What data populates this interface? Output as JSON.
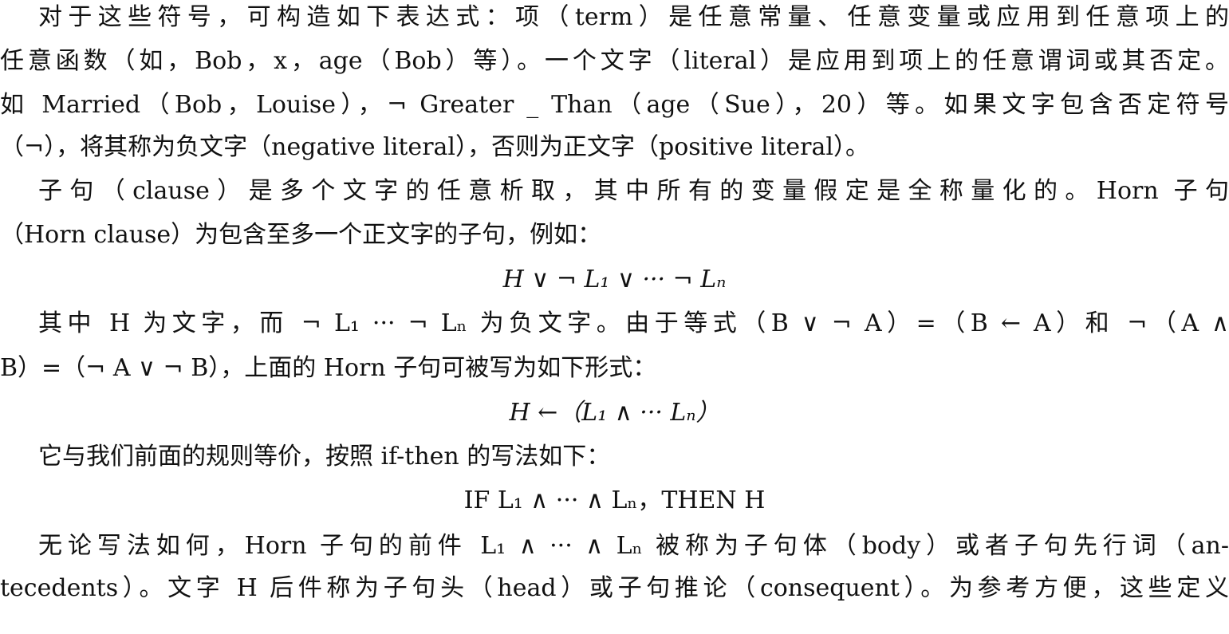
{
  "paragraphs": [
    {
      "lines": [
        "对于这些符号，可构造如下表达式：项（term）是任意常量、任意变量或应用到任意项上的",
        "任意函数（如，Bob，x，age（Bob）等）。一个文字（literal）是应用到项上的任意谓词或其否定。",
        "如 Married（Bob，Louise），¬ Greater _ Than（age（Sue），20）等。如果文字包含否定符号",
        "（¬），将其称为负文字（negative literal），否则为正文字（positive literal）。"
      ]
    },
    {
      "lines": [
        "子句（clause）是多个文字的任意析取，其中所有的变量假定是全称量化的。Horn 子句",
        "（Horn clause）为包含至多一个正文字的子句，例如："
      ]
    },
    {
      "formula": "H ∨ ¬ L₁ ∨ ··· ¬ Lₙ"
    },
    {
      "lines": [
        "其中 H 为文字，而 ¬ L₁ ··· ¬ Lₙ 为负文字。由于等式（B ∨ ¬ A）=（B ← A）和 ¬（A ∧",
        "B）=（¬ A ∨ ¬ B），上面的 Horn 子句可被写为如下形式："
      ]
    },
    {
      "formula": "H ←（L₁ ∧ ··· Lₙ）"
    },
    {
      "lines": [
        "它与我们前面的规则等价，按照 if-then 的写法如下："
      ]
    },
    {
      "formula": "IF L₁ ∧ ··· ∧ Lₙ，THEN H"
    },
    {
      "lines": [
        "无论写法如何，Horn 子句的前件 L₁ ∧ ··· ∧ Lₙ 被称为子句体（body）或者子句先行词（an-",
        "tecedents）。文字 H 后件称为子句头（head）或子句推论（consequent）。为参考方便，这些定义"
      ]
    }
  ]
}
